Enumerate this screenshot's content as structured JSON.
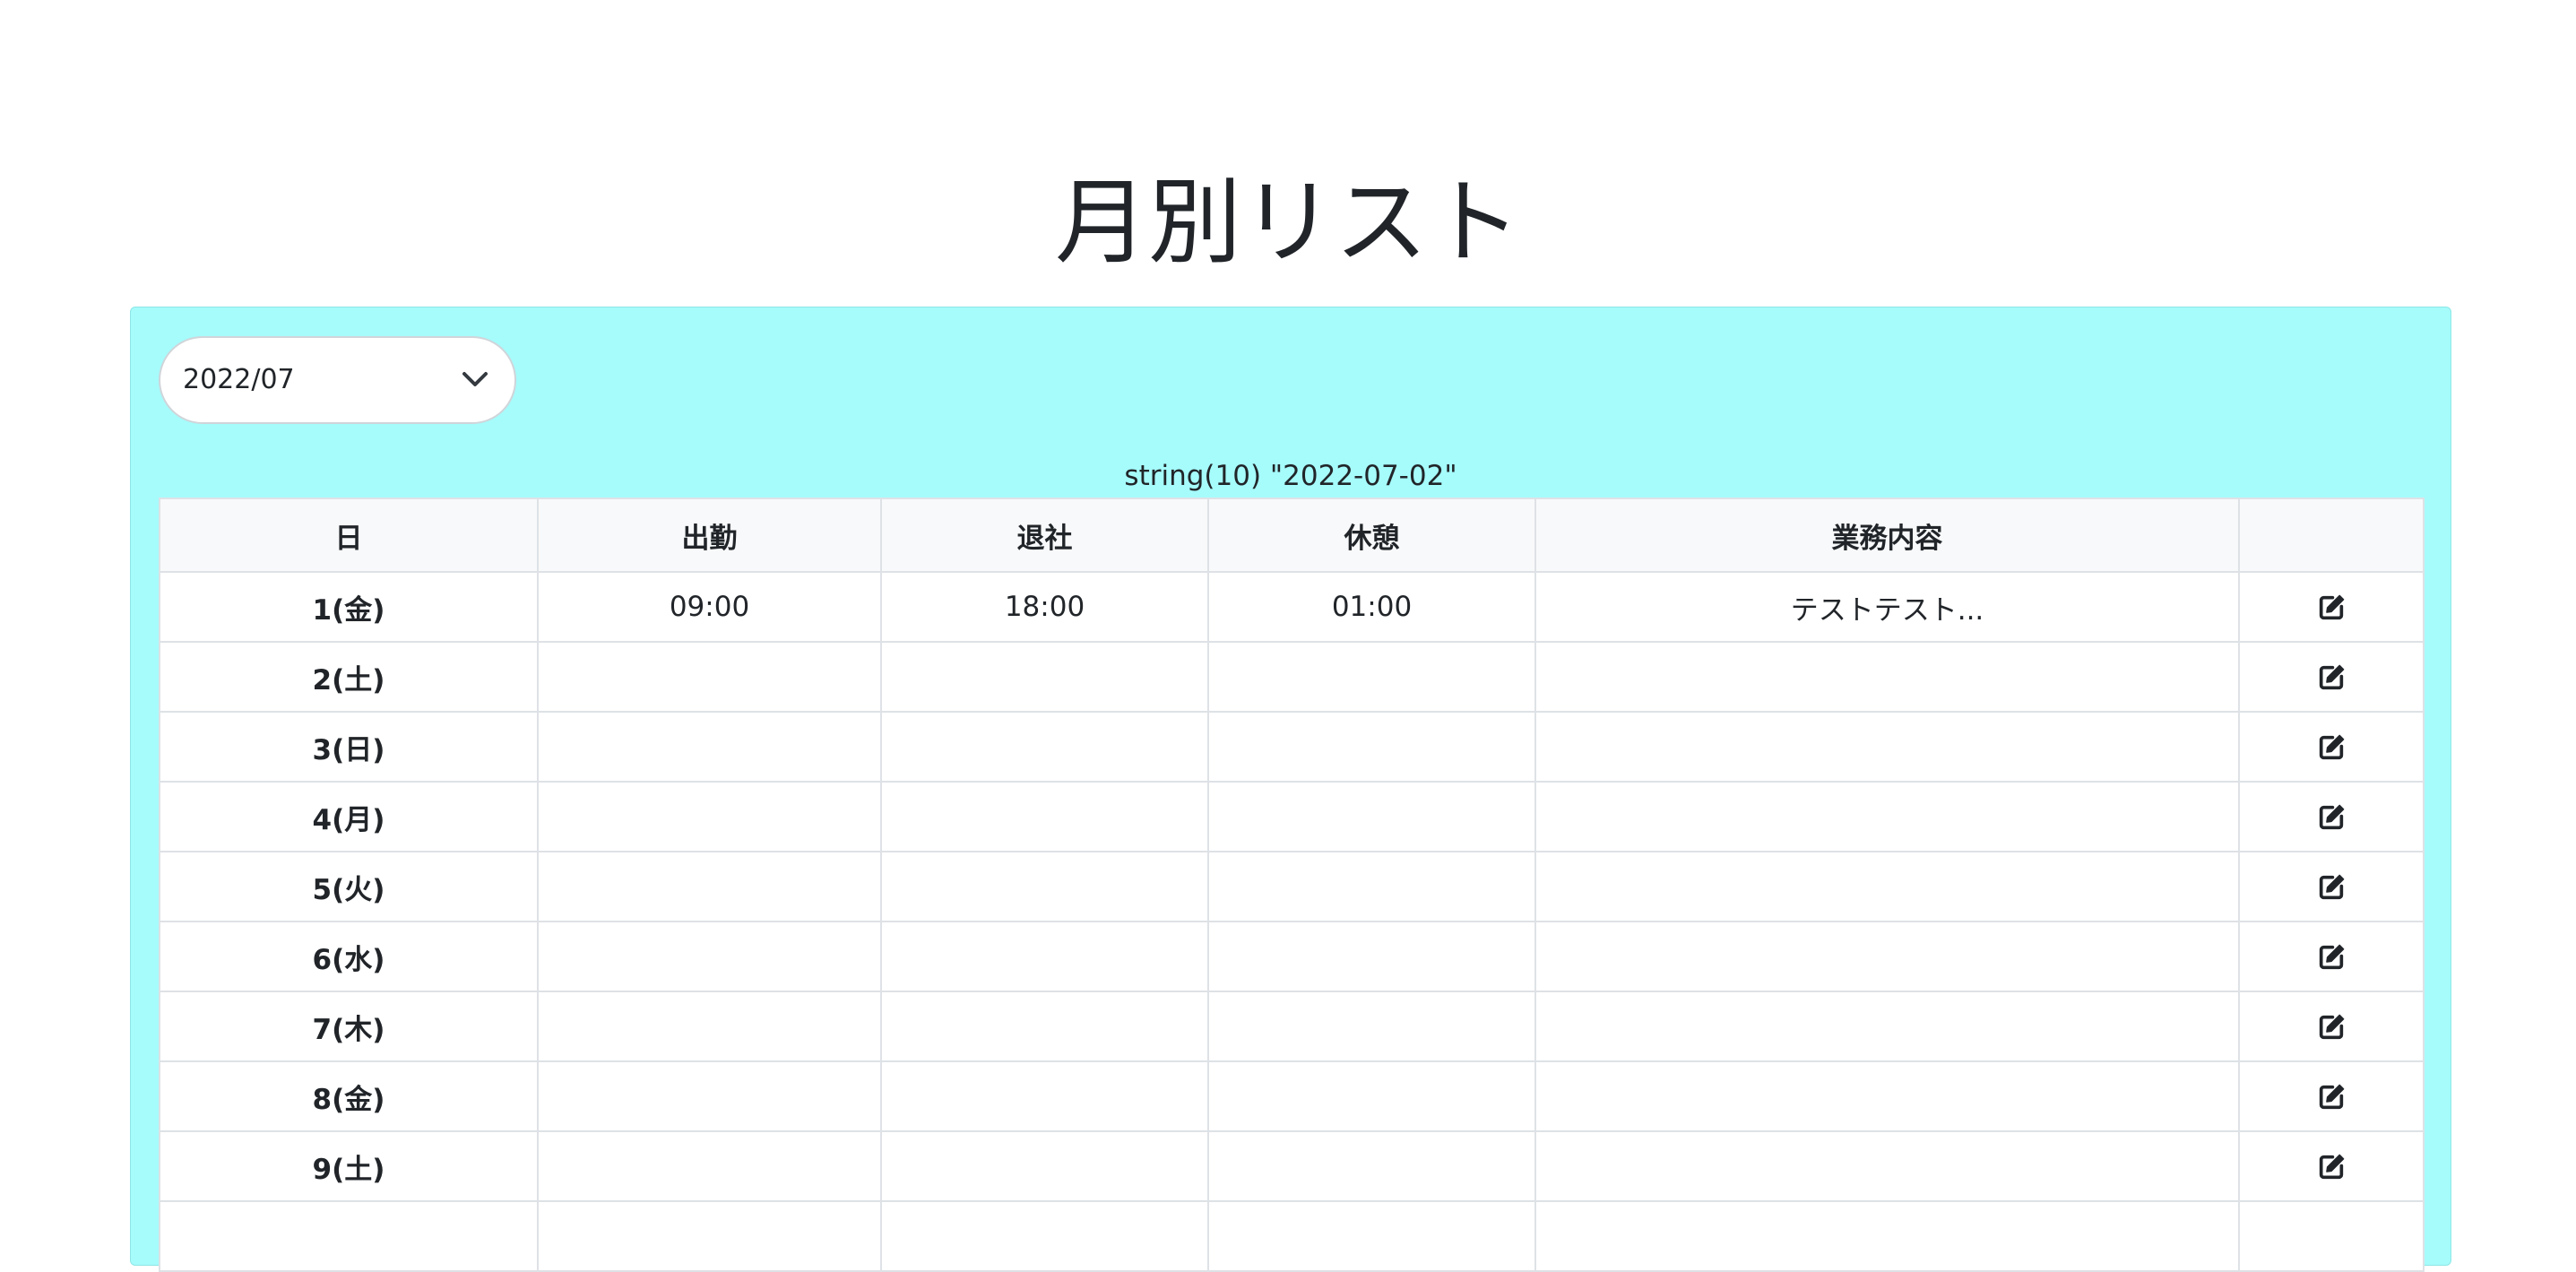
{
  "page": {
    "title": "月別リスト"
  },
  "colors": {
    "panel_background": "#a6fbfb",
    "header_background": "#f8f9fa",
    "border": "#dee2e6",
    "text": "#212529"
  },
  "month_selector": {
    "selected": "2022/07",
    "icon": "chevron-down-icon"
  },
  "debug_output": "string(10) \"2022-07-02\"",
  "table": {
    "headers": {
      "day": "日",
      "clock_in": "出勤",
      "clock_out": "退社",
      "break": "休憩",
      "work_content": "業務内容",
      "action": ""
    },
    "rows": [
      {
        "day": "1(金)",
        "clock_in": "09:00",
        "clock_out": "18:00",
        "break": "01:00",
        "work_content": "テストテスト...",
        "action_icon": "edit-icon"
      },
      {
        "day": "2(土)",
        "clock_in": "",
        "clock_out": "",
        "break": "",
        "work_content": "",
        "action_icon": "edit-icon"
      },
      {
        "day": "3(日)",
        "clock_in": "",
        "clock_out": "",
        "break": "",
        "work_content": "",
        "action_icon": "edit-icon"
      },
      {
        "day": "4(月)",
        "clock_in": "",
        "clock_out": "",
        "break": "",
        "work_content": "",
        "action_icon": "edit-icon"
      },
      {
        "day": "5(火)",
        "clock_in": "",
        "clock_out": "",
        "break": "",
        "work_content": "",
        "action_icon": "edit-icon"
      },
      {
        "day": "6(水)",
        "clock_in": "",
        "clock_out": "",
        "break": "",
        "work_content": "",
        "action_icon": "edit-icon"
      },
      {
        "day": "7(木)",
        "clock_in": "",
        "clock_out": "",
        "break": "",
        "work_content": "",
        "action_icon": "edit-icon"
      },
      {
        "day": "8(金)",
        "clock_in": "",
        "clock_out": "",
        "break": "",
        "work_content": "",
        "action_icon": "edit-icon"
      },
      {
        "day": "9(土)",
        "clock_in": "",
        "clock_out": "",
        "break": "",
        "work_content": "",
        "action_icon": "edit-icon"
      },
      {
        "day": "",
        "clock_in": "",
        "clock_out": "",
        "break": "",
        "work_content": "",
        "action_icon": ""
      }
    ]
  }
}
